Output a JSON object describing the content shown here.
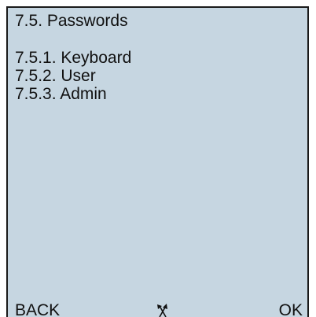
{
  "screen": {
    "title": "7.5. Passwords"
  },
  "menu": {
    "items": [
      {
        "label": "7.5.1. Keyboard"
      },
      {
        "label": "7.5.2. User"
      },
      {
        "label": "7.5.3. Admin"
      }
    ]
  },
  "softkeys": {
    "left_label": "BACK",
    "center_icon": "up-down-arrows-icon",
    "right_label": "OK"
  },
  "colors": {
    "lcd_background": "#c6d6e1",
    "text": "#111111",
    "border": "#1a1a1a"
  }
}
